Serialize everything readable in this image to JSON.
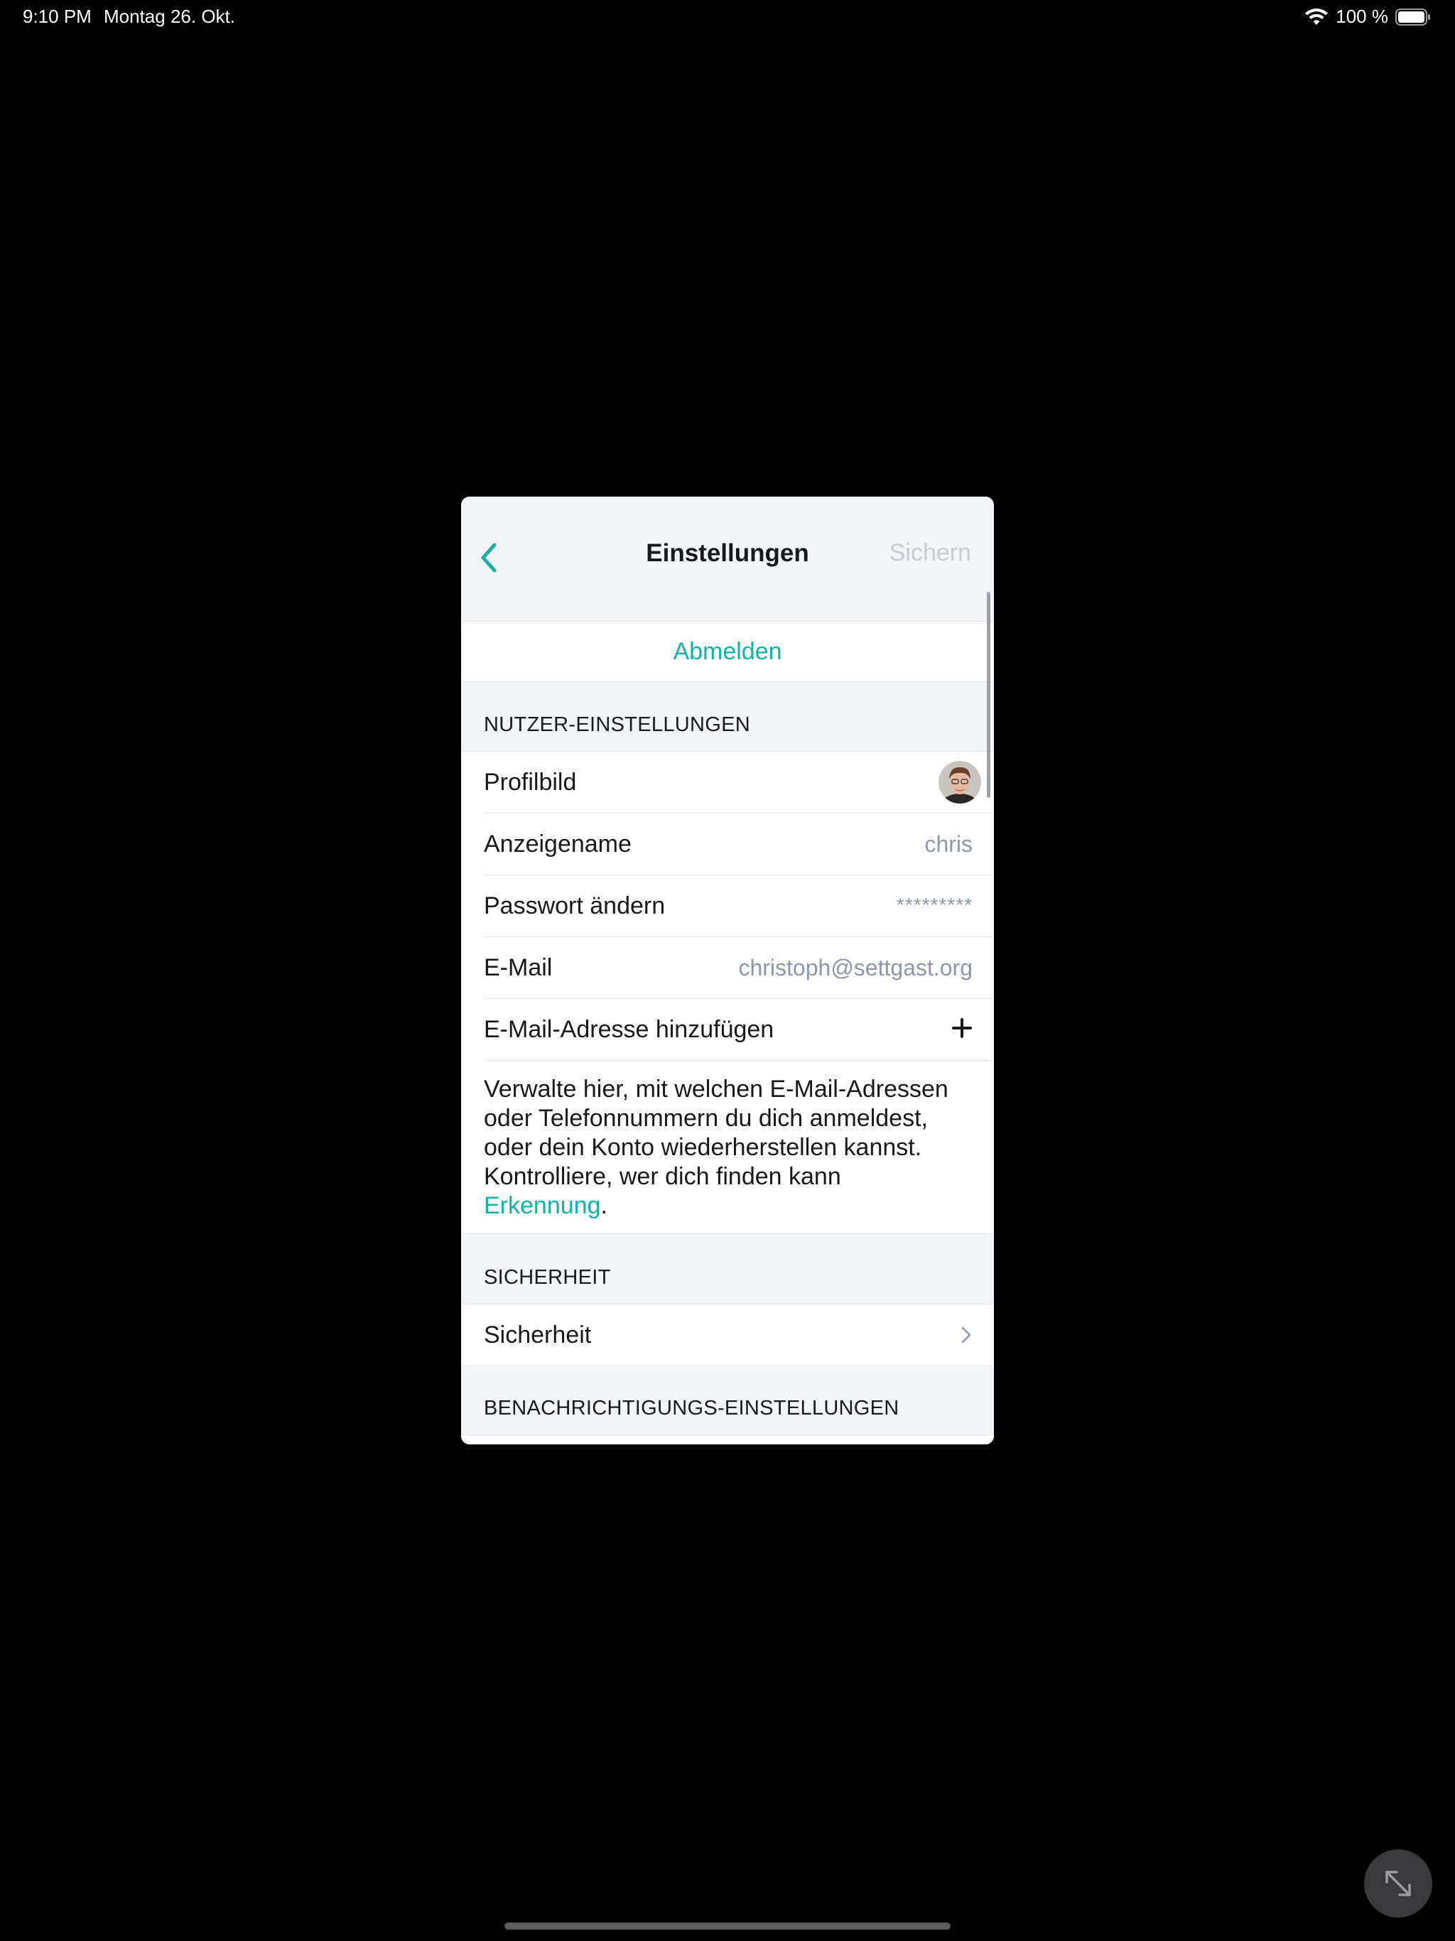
{
  "status_bar": {
    "time": "9:10 PM",
    "date": "Montag 26. Okt.",
    "battery": "100 %",
    "icons": [
      "wifi-icon",
      "battery-icon"
    ]
  },
  "nav": {
    "back_icon": "chevron-left-icon",
    "title": "Einstellungen",
    "save_label": "Sichern"
  },
  "logout": {
    "label": "Abmelden"
  },
  "user_settings": {
    "header": "NUTZER-EINSTELLUNGEN",
    "profile_picture_label": "Profilbild",
    "display_name_label": "Anzeigename",
    "display_name_value": "chris",
    "password_label": "Passwort ändern",
    "password_value": "*********",
    "email_label": "E-Mail",
    "email_value": "christoph@settgast.org",
    "add_email_label": "E-Mail-Adresse hinzufügen",
    "help_text": "Verwalte hier, mit welchen E-Mail-Adressen oder Telefonnummern du dich anmeldest, oder dein Konto wiederherstellen kannst. Kontrolliere, wer dich finden kann ",
    "help_link": "Erkennung",
    "help_end": "."
  },
  "security": {
    "header": "SICHERHEIT",
    "row_label": "Sicherheit"
  },
  "notifications": {
    "header": "BENACHRICHTIGUNGS-EINSTELLUNGEN"
  },
  "colors": {
    "accent": "#11b3a6",
    "background": "#000000",
    "panel": "#f4f5f8",
    "muted": "#8d97a5"
  }
}
